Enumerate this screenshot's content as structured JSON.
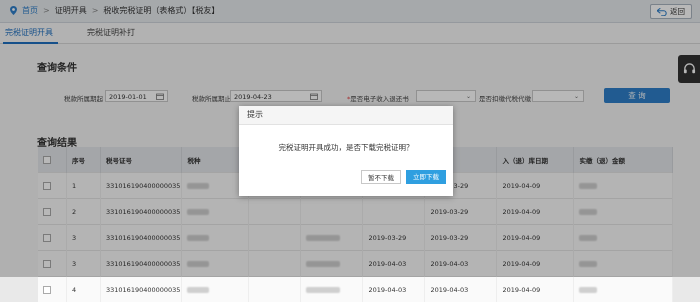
{
  "breadcrumb": {
    "home": "首页",
    "items": [
      "证明开具",
      "税收完税证明（表格式）【税友】"
    ]
  },
  "back_label": "返回",
  "tabs": [
    {
      "label": "完税证明开具",
      "active": true
    },
    {
      "label": "完税证明补打",
      "active": false
    }
  ],
  "query": {
    "title": "查询条件",
    "start_label": "税款所属期起",
    "start_value": "2019-01-01",
    "end_label": "税款所属期止",
    "end_value": "2019-04-23",
    "electronic_label": "是否电子收入退还书",
    "agent_label": "是否扣缴代税代缴",
    "search_button": "查 询"
  },
  "results": {
    "title": "查询结果",
    "columns": [
      "序号",
      "税号证号",
      "税种",
      "",
      "",
      "",
      "属期止",
      "入（退）库日期",
      "实缴（退）金额"
    ],
    "rows": [
      {
        "no": "1",
        "id": "331016190400000035",
        "end": "2019-03-29",
        "date": "2019-04-09"
      },
      {
        "no": "2",
        "id": "331016190400000035",
        "end": "2019-03-29",
        "date": "2019-04-09"
      },
      {
        "no": "3",
        "id": "331016190400000035",
        "start": "2019-03-29",
        "end": "2019-03-29",
        "date": "2019-04-09"
      },
      {
        "no": "3",
        "id": "331016190400000035",
        "start": "2019-04-03",
        "end": "2019-04-03",
        "date": "2019-04-09"
      },
      {
        "no": "4",
        "id": "331016190400000035",
        "start": "2019-04-03",
        "end": "2019-04-03",
        "date": "2019-04-09"
      }
    ]
  },
  "dialog": {
    "title": "提示",
    "message": "完税证明开具成功，是否下载完税证明？",
    "cancel": "暂不下载",
    "confirm": "立即下载"
  }
}
